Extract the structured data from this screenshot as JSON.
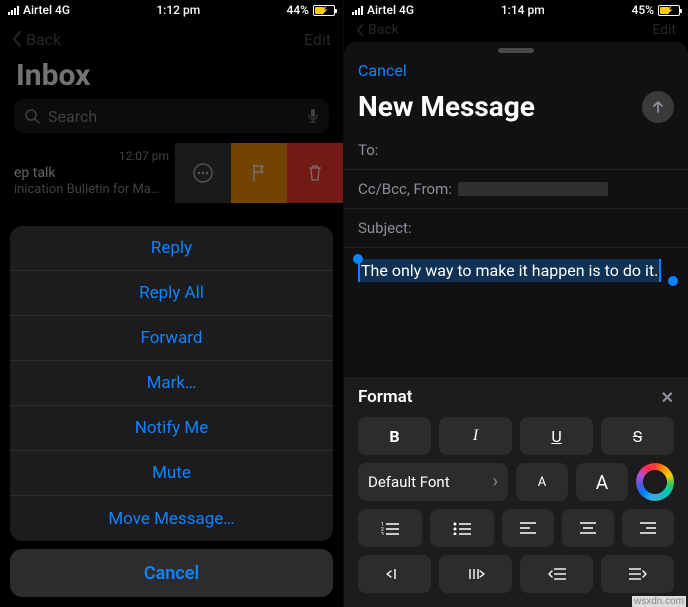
{
  "left": {
    "status": {
      "carrier": "Airtel 4G",
      "time": "1:12 pm",
      "battery": "44%"
    },
    "nav": {
      "back": "Back",
      "edit": "Edit"
    },
    "inbox_title": "Inbox",
    "search_placeholder": "Search",
    "mailrow": {
      "time": "12:07 pm",
      "subject": "ep talk",
      "preview": "inication Bulletin for Ma…"
    },
    "sheet": {
      "items": [
        "Reply",
        "Reply All",
        "Forward",
        "Mark…",
        "Notify Me",
        "Mute",
        "Move Message…"
      ],
      "cancel": "Cancel"
    }
  },
  "right": {
    "status": {
      "carrier": "Airtel 4G",
      "time": "1:14 pm",
      "battery": "45%"
    },
    "nav_back_faded": "Back",
    "nav_edit_faded": "Edit",
    "compose": {
      "cancel": "Cancel",
      "title": "New Message",
      "to_label": "To:",
      "cc_label": "Cc/Bcc, From:",
      "subject_label": "Subject:",
      "body_selected": "The only way to make it happen is to do it."
    },
    "format": {
      "title": "Format",
      "bold": "B",
      "italic": "I",
      "underline": "U",
      "strike": "S",
      "default_font": "Default Font",
      "size_small": "A",
      "size_large": "A"
    }
  },
  "watermark": "wsxdn.com"
}
